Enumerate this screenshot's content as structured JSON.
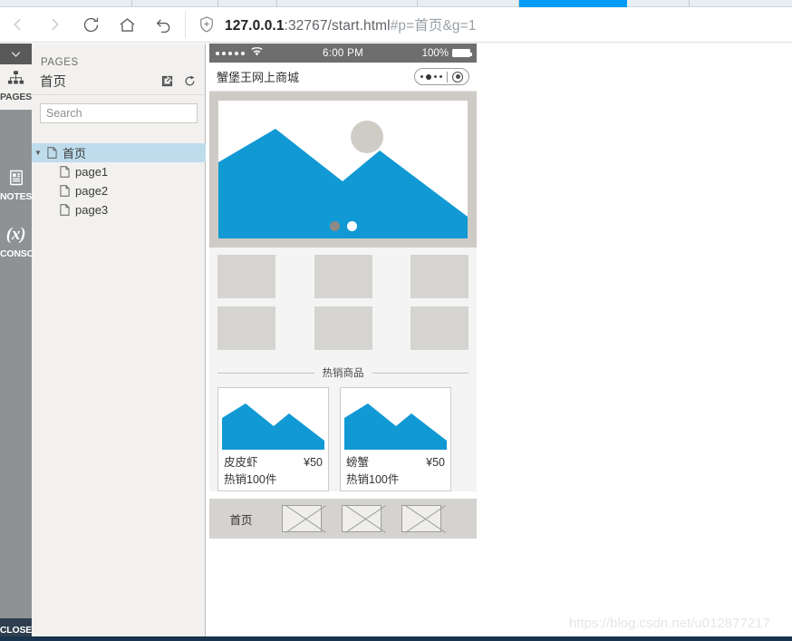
{
  "browser": {
    "nav": {
      "back": "back-arrow",
      "forward": "forward-arrow",
      "reload": "reload-icon",
      "home": "home-icon",
      "undo": "undo-icon"
    },
    "address": {
      "shield_icon": "shield-icon",
      "host": "127.0.0.1",
      "port_path": ":32767/start.html",
      "fragment": "#p=首页&g=1",
      "full": "127.0.0.1:32767/start.html#p=首页&g=1"
    },
    "tabs": {
      "active_accent": "#029bf5"
    }
  },
  "rail": {
    "collapse_icon": "chevron-down-icon",
    "items": [
      {
        "label": "PAGES",
        "icon": "sitemap-icon",
        "active": true
      },
      {
        "label": "NOTES",
        "icon": "note-icon",
        "active": false
      },
      {
        "label": "CONSOLE",
        "icon": "variable-icon",
        "active": false
      }
    ],
    "close_label": "CLOSE"
  },
  "panel": {
    "kicker": "PAGES",
    "title": "首页",
    "actions": [
      {
        "name": "open-in-new-icon"
      },
      {
        "name": "reload-page-icon"
      }
    ],
    "search": {
      "value": "",
      "placeholder": "Search"
    },
    "tree": [
      {
        "label": "首页",
        "level": 0,
        "selected": true,
        "expanded": true
      },
      {
        "label": "page1",
        "level": 1,
        "selected": false
      },
      {
        "label": "page2",
        "level": 1,
        "selected": false
      },
      {
        "label": "page3",
        "level": 1,
        "selected": false
      }
    ]
  },
  "preview": {
    "statusbar": {
      "signal_dots": 5,
      "wifi_icon": "wifi-icon",
      "time": "6:00 PM",
      "battery_percent": "100%",
      "battery_icon": "battery-full-icon"
    },
    "navbar": {
      "title": "蟹堡王网上商城",
      "right_control": "page-control-icon"
    },
    "carousel": {
      "image_placeholder": "image-placeholder-icon",
      "dots": [
        {
          "state": "active"
        },
        {
          "state": "inactive"
        }
      ]
    },
    "grid": {
      "rows": [
        [
          "cell-1",
          "cell-2",
          "cell-3"
        ],
        [
          "cell-4",
          "cell-5",
          "cell-6"
        ]
      ]
    },
    "section_divider": {
      "text": "热销商品"
    },
    "products": [
      {
        "name": "皮皮虾",
        "price": "¥50",
        "sold": "热销100件",
        "image": "image-placeholder-icon"
      },
      {
        "name": "螃蟹",
        "price": "¥50",
        "sold": "热销100件",
        "image": "image-placeholder-icon"
      }
    ],
    "tabbar": {
      "home_label": "首页",
      "placeholders": [
        "tab-placeholder-1",
        "tab-placeholder-2",
        "tab-placeholder-3"
      ]
    },
    "colors": {
      "accent_blue": "#1199d4",
      "placeholder_gray": "#d6d4d0",
      "chrome_gray": "#6e6e6e"
    }
  },
  "watermark": {
    "text": "https://blog.csdn.net/u012877217"
  }
}
